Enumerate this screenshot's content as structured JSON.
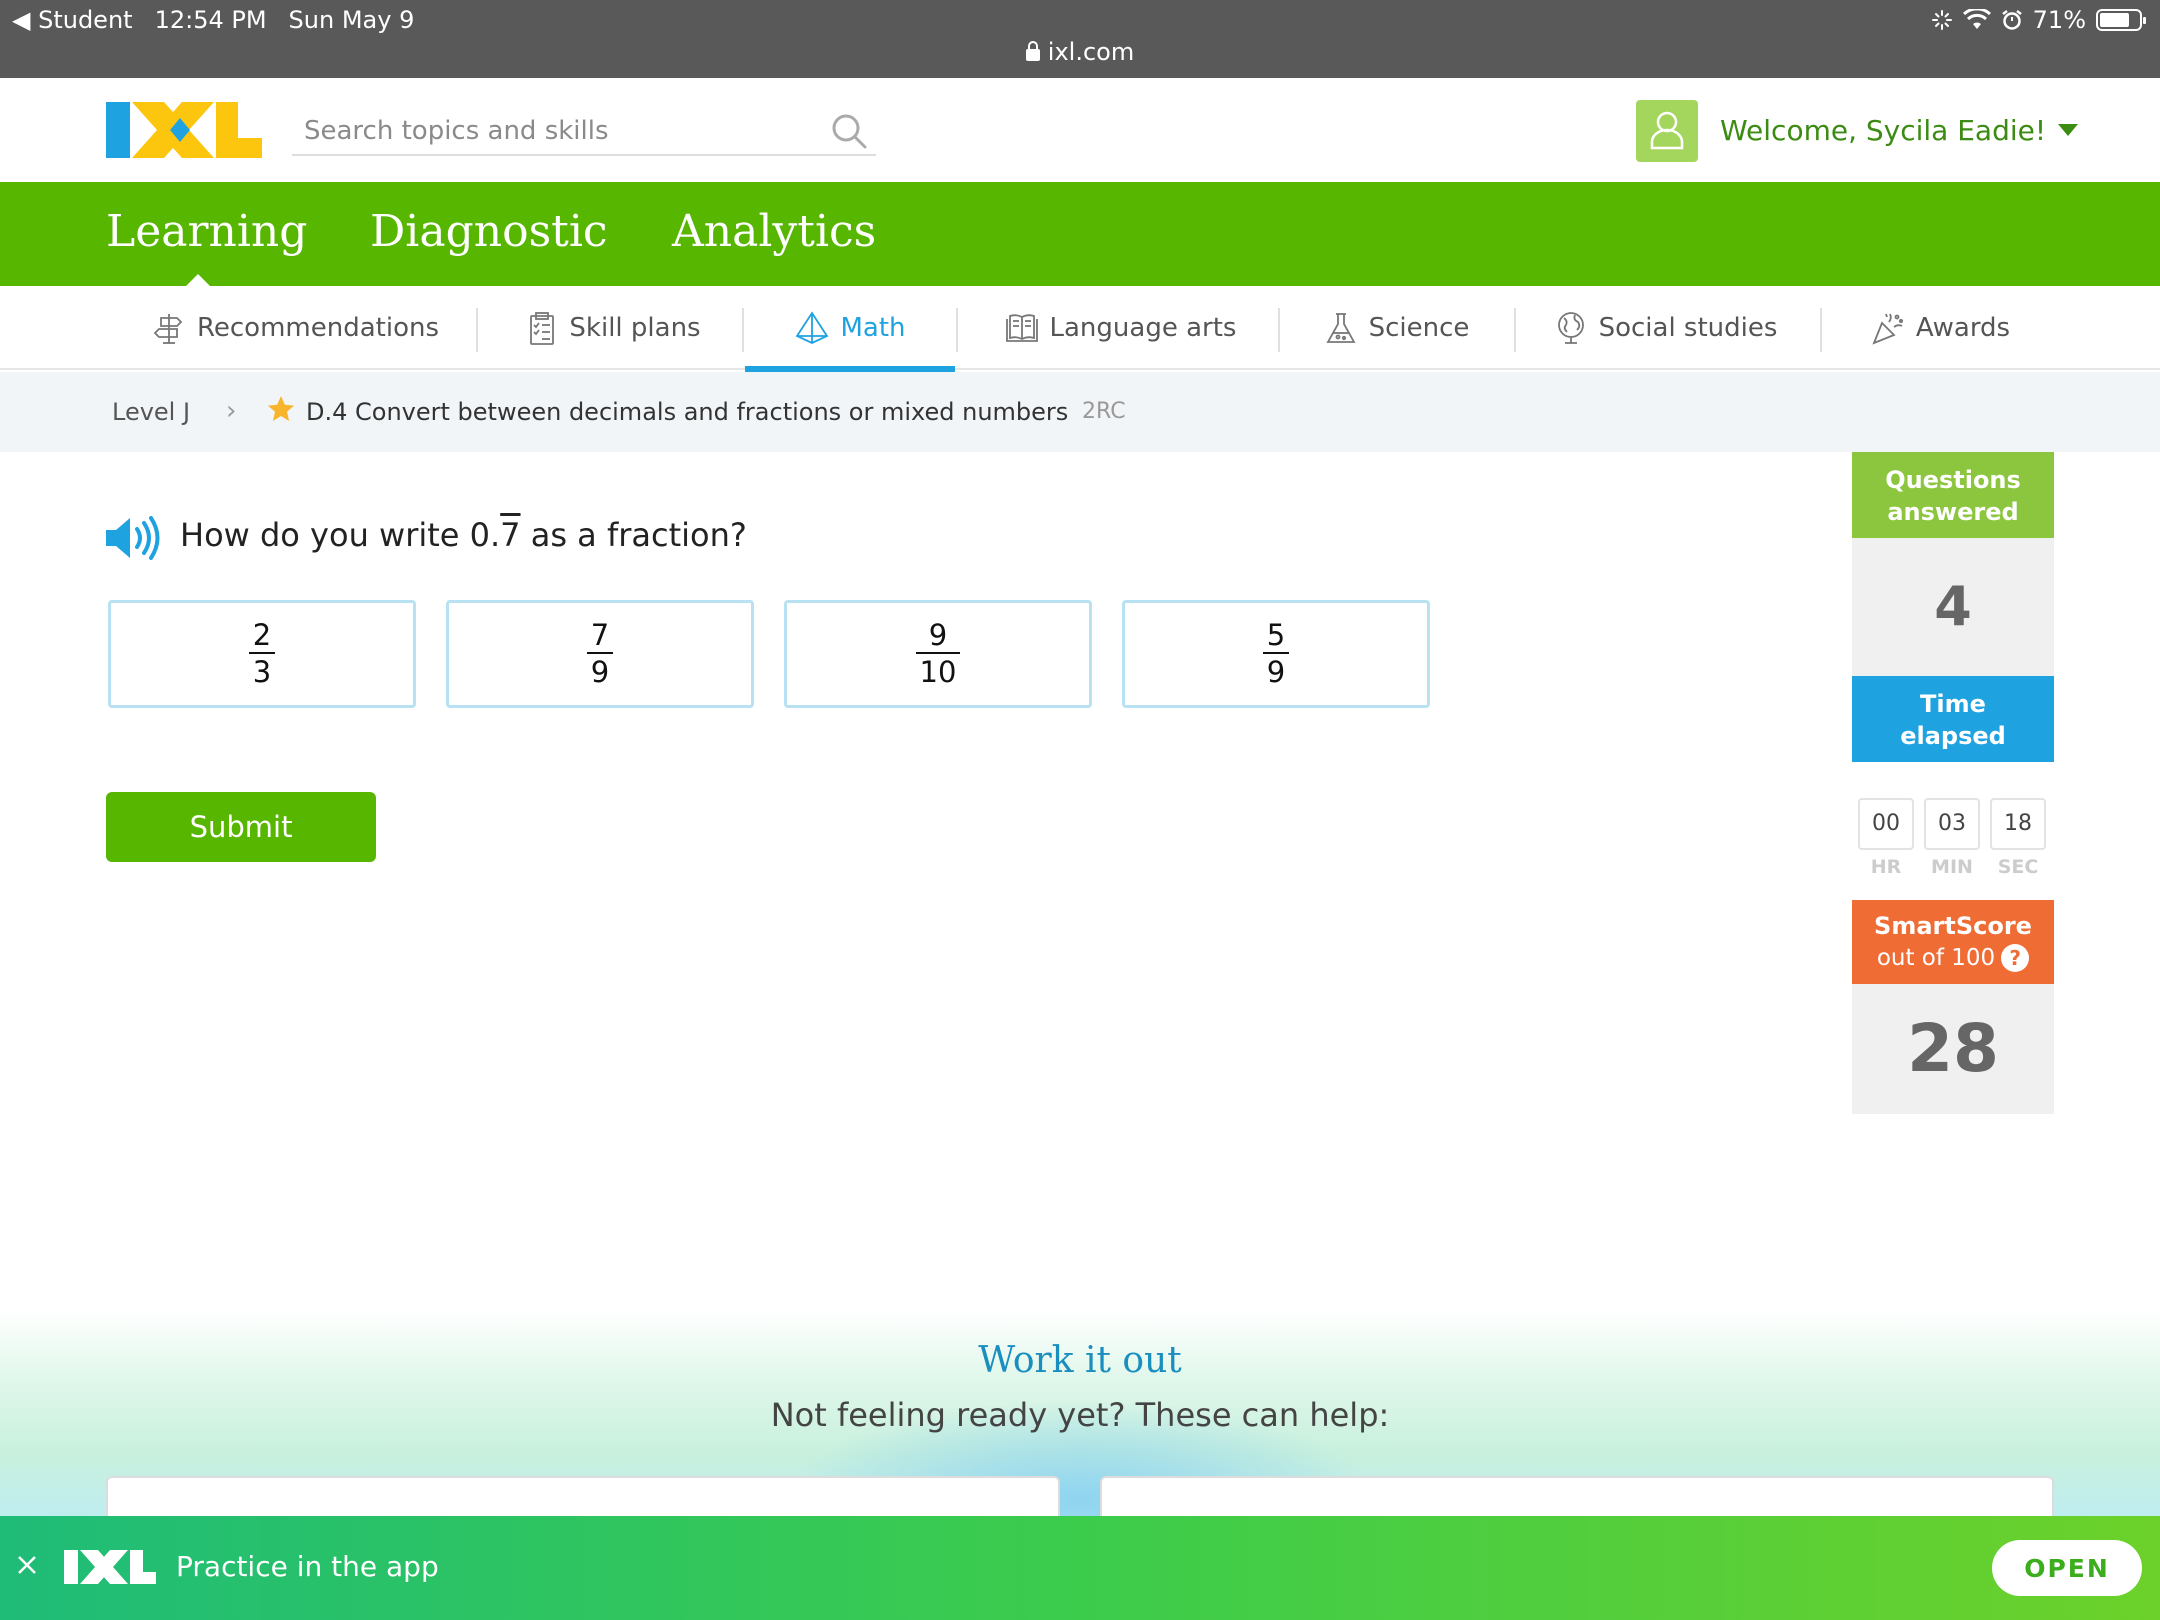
{
  "status_bar": {
    "back_app": "◀ Student",
    "time": "12:54 PM",
    "date": "Sun May 9",
    "battery": "71%",
    "url": "ixl.com"
  },
  "header": {
    "search_placeholder": "Search topics and skills",
    "welcome": "Welcome, Sycila Eadie!"
  },
  "main_nav": {
    "items": [
      {
        "label": "Learning"
      },
      {
        "label": "Diagnostic"
      },
      {
        "label": "Analytics"
      }
    ],
    "active": "Learning"
  },
  "subject_tabs": {
    "items": [
      {
        "label": "Recommendations",
        "icon": "signpost-icon"
      },
      {
        "label": "Skill plans",
        "icon": "checklist-icon"
      },
      {
        "label": "Math",
        "icon": "pyramid-icon"
      },
      {
        "label": "Language arts",
        "icon": "book-icon"
      },
      {
        "label": "Science",
        "icon": "flask-icon"
      },
      {
        "label": "Social studies",
        "icon": "globe-icon"
      },
      {
        "label": "Awards",
        "icon": "party-popper-icon"
      }
    ],
    "active": "Math"
  },
  "breadcrumb": {
    "level": "Level J",
    "skill": "D.4 Convert between decimals and fractions or mixed numbers",
    "code": "2RC"
  },
  "question": {
    "prefix": "How do you write 0.",
    "repeating_digit": "7",
    "suffix": " as a fraction?"
  },
  "answers": [
    {
      "numerator": "2",
      "denominator": "3"
    },
    {
      "numerator": "7",
      "denominator": "9"
    },
    {
      "numerator": "9",
      "denominator": "10"
    },
    {
      "numerator": "5",
      "denominator": "9"
    }
  ],
  "submit_label": "Submit",
  "stats": {
    "questions_label_1": "Questions",
    "questions_label_2": "answered",
    "questions_answered": "4",
    "time_label_1": "Time",
    "time_label_2": "elapsed",
    "hours": "00",
    "minutes": "03",
    "seconds": "18",
    "hr_label": "HR",
    "min_label": "MIN",
    "sec_label": "SEC",
    "smartscore_label": "SmartScore",
    "smartscore_sub": "out of 100",
    "smartscore": "28"
  },
  "work_it_out": {
    "title": "Work it out",
    "subtitle": "Not feeling ready yet? These can help:"
  },
  "app_banner": {
    "text": "Practice in the app",
    "open_label": "OPEN"
  },
  "colors": {
    "brand_green": "#56b600",
    "brand_blue": "#1fa2e0",
    "smartscore_orange": "#ef6c35",
    "questions_green": "#8cc63e"
  }
}
